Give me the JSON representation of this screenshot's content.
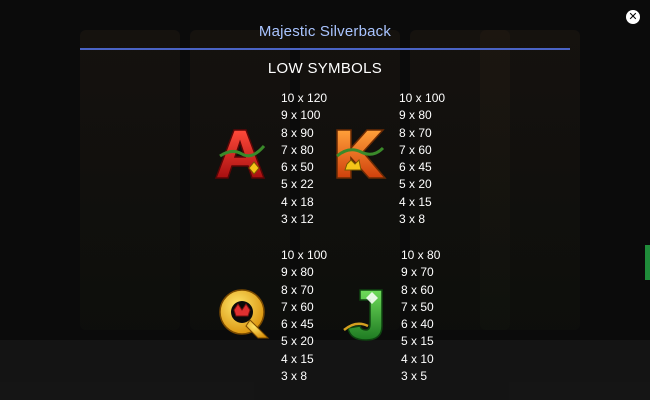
{
  "header": {
    "title": "Majestic Silverback",
    "close_icon": "close-icon"
  },
  "section": {
    "title": "LOW SYMBOLS"
  },
  "symbols": [
    {
      "name": "A",
      "color": "#d81e1e",
      "pays": [
        "10 x 120",
        "9 x 100",
        "8 x 90",
        "7 x 80",
        "6 x 50",
        "5 x 22",
        "4 x 18",
        "3 x 12"
      ]
    },
    {
      "name": "K",
      "color": "#f07a16",
      "pays": [
        "10 x 100",
        "9 x 80",
        "8 x 70",
        "7 x 60",
        "6 x 45",
        "5 x 20",
        "4 x 15",
        "3 x 8"
      ]
    },
    {
      "name": "Q",
      "color": "#f2c418",
      "pays": [
        "10 x 100",
        "9 x 80",
        "8 x 70",
        "7 x 60",
        "6 x 45",
        "5 x 20",
        "4 x 15",
        "3 x 8"
      ]
    },
    {
      "name": "J",
      "color": "#2fae3a",
      "pays": [
        "10 x 80",
        "9 x 70",
        "8 x 60",
        "7 x 50",
        "6 x 40",
        "5 x 15",
        "4 x 10",
        "3 x 5"
      ]
    }
  ]
}
